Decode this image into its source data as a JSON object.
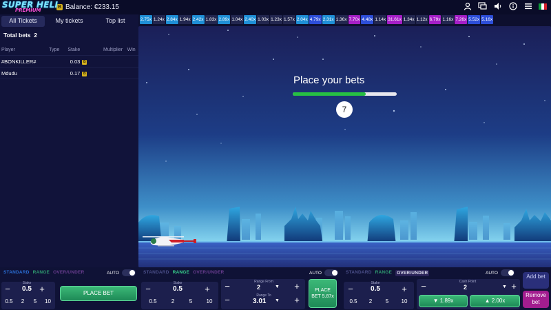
{
  "header": {
    "logo_main": "SUPER HELI",
    "logo_sub": "PREMIUM",
    "balance_icon": "B",
    "balance": "Balance: €233.15",
    "icons": [
      "user-icon",
      "chat-icon",
      "sound-icon",
      "info-icon",
      "menu-icon",
      "flag-icon"
    ],
    "flag_colors": [
      "#0d9b3a",
      "#ffffff",
      "#d4202c"
    ]
  },
  "left_panel": {
    "tabs": [
      "All Tickets",
      "My tickets",
      "Top list"
    ],
    "total_label": "Total bets",
    "total_value": "2",
    "columns": [
      "Player",
      "Type",
      "Stake",
      "Multiplier",
      "Win"
    ],
    "rows": [
      {
        "player": "#BONKILLER#",
        "type": "",
        "stake": "0.03",
        "multiplier": "",
        "win": ""
      },
      {
        "player": "Mdudu",
        "type": "",
        "stake": "0.17",
        "multiplier": "",
        "win": ""
      }
    ]
  },
  "history": [
    {
      "v": "2.75x",
      "c": "#1f8fd6"
    },
    {
      "v": "1.24x",
      "c": "#22264f"
    },
    {
      "v": "2.84x",
      "c": "#1f8fd6"
    },
    {
      "v": "1.94x",
      "c": "#22264f"
    },
    {
      "v": "2.42x",
      "c": "#1f8fd6"
    },
    {
      "v": "1.83x",
      "c": "#22264f"
    },
    {
      "v": "2.89x",
      "c": "#1f8fd6"
    },
    {
      "v": "1.04x",
      "c": "#22264f"
    },
    {
      "v": "2.40x",
      "c": "#1f8fd6"
    },
    {
      "v": "1.03x",
      "c": "#22264f"
    },
    {
      "v": "1.23x",
      "c": "#22264f"
    },
    {
      "v": "1.57x",
      "c": "#22264f"
    },
    {
      "v": "2.04x",
      "c": "#1f8fd6"
    },
    {
      "v": "4.79x",
      "c": "#2d4ed8"
    },
    {
      "v": "2.31x",
      "c": "#1f8fd6"
    },
    {
      "v": "1.36x",
      "c": "#22264f"
    },
    {
      "v": "7.70x",
      "c": "#a51fc7"
    },
    {
      "v": "4.48x",
      "c": "#2d4ed8"
    },
    {
      "v": "1.14x",
      "c": "#22264f"
    },
    {
      "v": "31.61x",
      "c": "#a51fc7"
    },
    {
      "v": "1.34x",
      "c": "#22264f"
    },
    {
      "v": "1.12x",
      "c": "#22264f"
    },
    {
      "v": "6.79x",
      "c": "#a51fc7"
    },
    {
      "v": "1.16x",
      "c": "#22264f"
    },
    {
      "v": "7.26x",
      "c": "#a51fc7"
    },
    {
      "v": "5.52x",
      "c": "#2d4ed8"
    },
    {
      "v": "5.16x",
      "c": "#2d4ed8"
    }
  ],
  "game": {
    "title": "Place your bets",
    "progress": 0.7,
    "countdown": "7"
  },
  "panel1": {
    "modes": [
      "STANDARD",
      "RANGE",
      "OVER/UNDER"
    ],
    "active_mode": "STANDARD",
    "auto_label": "AUTO",
    "stake_label": "Stake",
    "stake": "0.5",
    "quick": [
      "0.5",
      "2",
      "5",
      "10"
    ],
    "button": "PLACE BET"
  },
  "panel2": {
    "modes": [
      "STANDARD",
      "RANGE",
      "OVER/UNDER"
    ],
    "active_mode": "RANGE",
    "auto_label": "AUTO",
    "stake_label": "Stake",
    "stake": "0.5",
    "quick": [
      "0.5",
      "2",
      "5",
      "10"
    ],
    "range_from_label": "Range From",
    "range_from": "2",
    "range_to_label": "Range To",
    "range_to": "3.01",
    "button_line1": "PLACE",
    "button_line2": "BET 5.87x"
  },
  "panel3": {
    "modes": [
      "STANDARD",
      "RANGE",
      "OVER/UNDER"
    ],
    "active_mode": "OVER/UNDER",
    "auto_label": "AUTO",
    "stake_label": "Stake",
    "stake": "0.5",
    "quick": [
      "0.5",
      "2",
      "5",
      "10"
    ],
    "cashout_label": "Cash Point",
    "cashout": "2",
    "under_button": "1.89x",
    "over_button": "2.00x",
    "add_bet": "Add bet",
    "remove_bet": "Remove bet"
  }
}
